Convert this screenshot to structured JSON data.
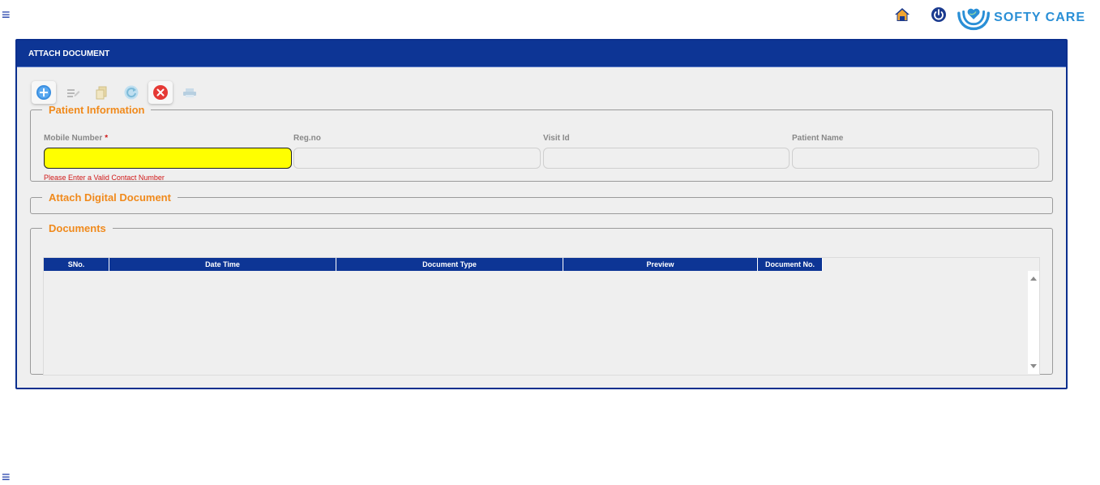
{
  "menu": {
    "glyph": "≡"
  },
  "header": {
    "brand_name": "SOFTY CARE"
  },
  "panel": {
    "title": "ATTACH DOCUMENT",
    "toolbar": [
      "add-icon",
      "edit-icon",
      "copy-icon",
      "refresh-icon",
      "close-icon",
      "print-icon"
    ]
  },
  "patient_info": {
    "legend": "Patient Information",
    "mobile_label": "Mobile Number",
    "mobile_required": "*",
    "mobile_value": "",
    "mobile_error": "Please Enter a Valid Contact Number",
    "reg_label": "Reg.no",
    "reg_value": "",
    "visit_label": "Visit Id",
    "visit_value": "",
    "patient_name_label": "Patient Name",
    "patient_name_value": ""
  },
  "attach": {
    "legend": "Attach Digital Document"
  },
  "documents": {
    "legend": "Documents",
    "columns": [
      "SNo.",
      "Date Time",
      "Document Type",
      "Preview",
      "Document No."
    ],
    "rows": []
  },
  "colors": {
    "primary": "#0d3595",
    "accent": "#f08a1c",
    "error": "#d01818",
    "invalid_bg": "#ffff00",
    "brand": "#2a8fd6"
  }
}
